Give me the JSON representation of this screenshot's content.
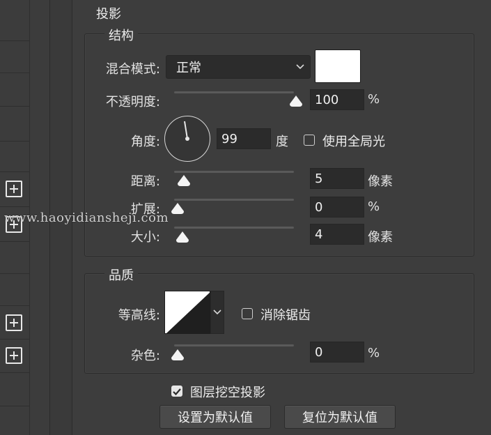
{
  "dialog": {
    "section_title": "投影",
    "structure": {
      "legend": "结构",
      "blend_mode": {
        "label": "混合模式:",
        "value": "正常",
        "color": "#ffffff"
      },
      "opacity": {
        "label": "不透明度:",
        "value": "100",
        "unit": "%",
        "level": 1.0
      },
      "angle": {
        "label": "角度:",
        "value": "99",
        "unit": "度",
        "global_light_label": "使用全局光",
        "global_light_checked": false
      },
      "distance": {
        "label": "距离:",
        "value": "5",
        "unit": "像素",
        "level": 0.05
      },
      "spread": {
        "label": "扩展:",
        "value": "0",
        "unit": "%",
        "level": 0.0
      },
      "size": {
        "label": "大小:",
        "value": "4",
        "unit": "像素",
        "level": 0.04
      }
    },
    "quality": {
      "legend": "品质",
      "contour": {
        "label": "等高线:",
        "anti_alias_label": "消除锯齿",
        "anti_alias_checked": false
      },
      "noise": {
        "label": "杂色:",
        "value": "0",
        "unit": "%",
        "level": 0.0
      }
    },
    "knockout": {
      "label": "图层挖空投影",
      "checked": true
    },
    "buttons": {
      "make_default": "设置为默认值",
      "reset_default": "复位为默认值"
    }
  },
  "watermark": "www.haoyidiansheji.com"
}
